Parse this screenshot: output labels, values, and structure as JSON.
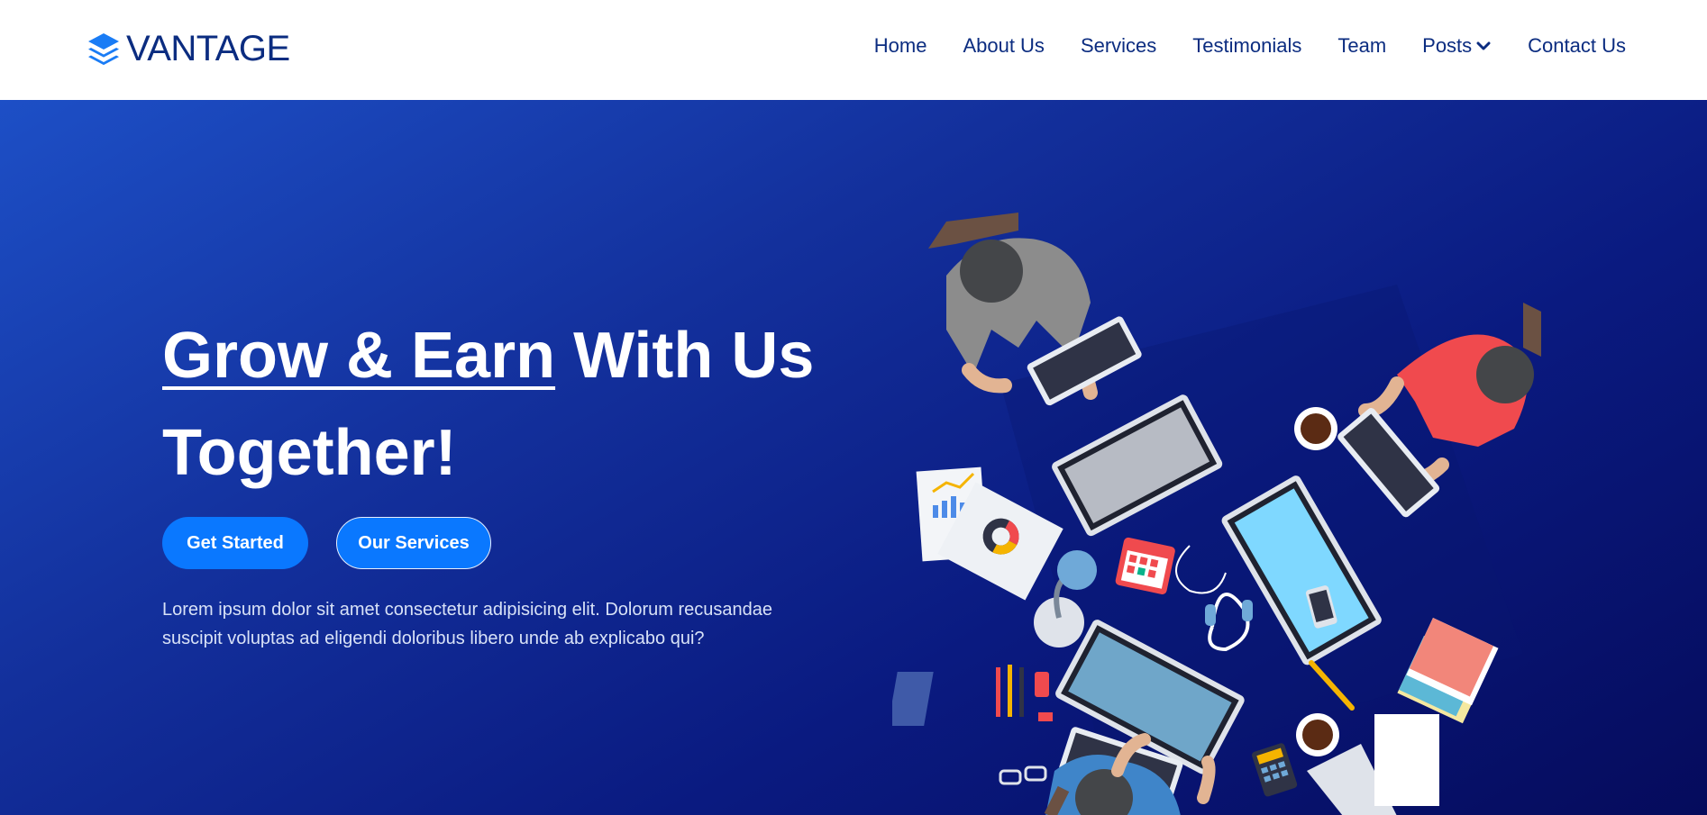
{
  "brand": {
    "name": "VANTAGE",
    "icon": "layers-icon"
  },
  "nav": {
    "items": [
      {
        "label": "Home"
      },
      {
        "label": "About Us"
      },
      {
        "label": "Services"
      },
      {
        "label": "Testimonials"
      },
      {
        "label": "Team"
      },
      {
        "label": "Posts",
        "icon": "chevron-down-icon"
      },
      {
        "label": "Contact Us"
      }
    ]
  },
  "hero": {
    "headline_underlined": "Grow & Earn",
    "headline_rest": " With Us Together!",
    "primary_button": "Get Started",
    "secondary_button": "Our Services",
    "description": "Lorem ipsum dolor sit amet consectetur adipisicing elit. Dolorum recusandae suscipit voluptas ad eligendi doloribus libero unde ab explicabo qui?",
    "illustration": "team-working-at-desk-illustration"
  },
  "colors": {
    "brand": "#0b2c80",
    "accent": "#0a78ff",
    "hero_gradient_start": "#1d4fc6",
    "hero_gradient_end": "#050b5c"
  }
}
